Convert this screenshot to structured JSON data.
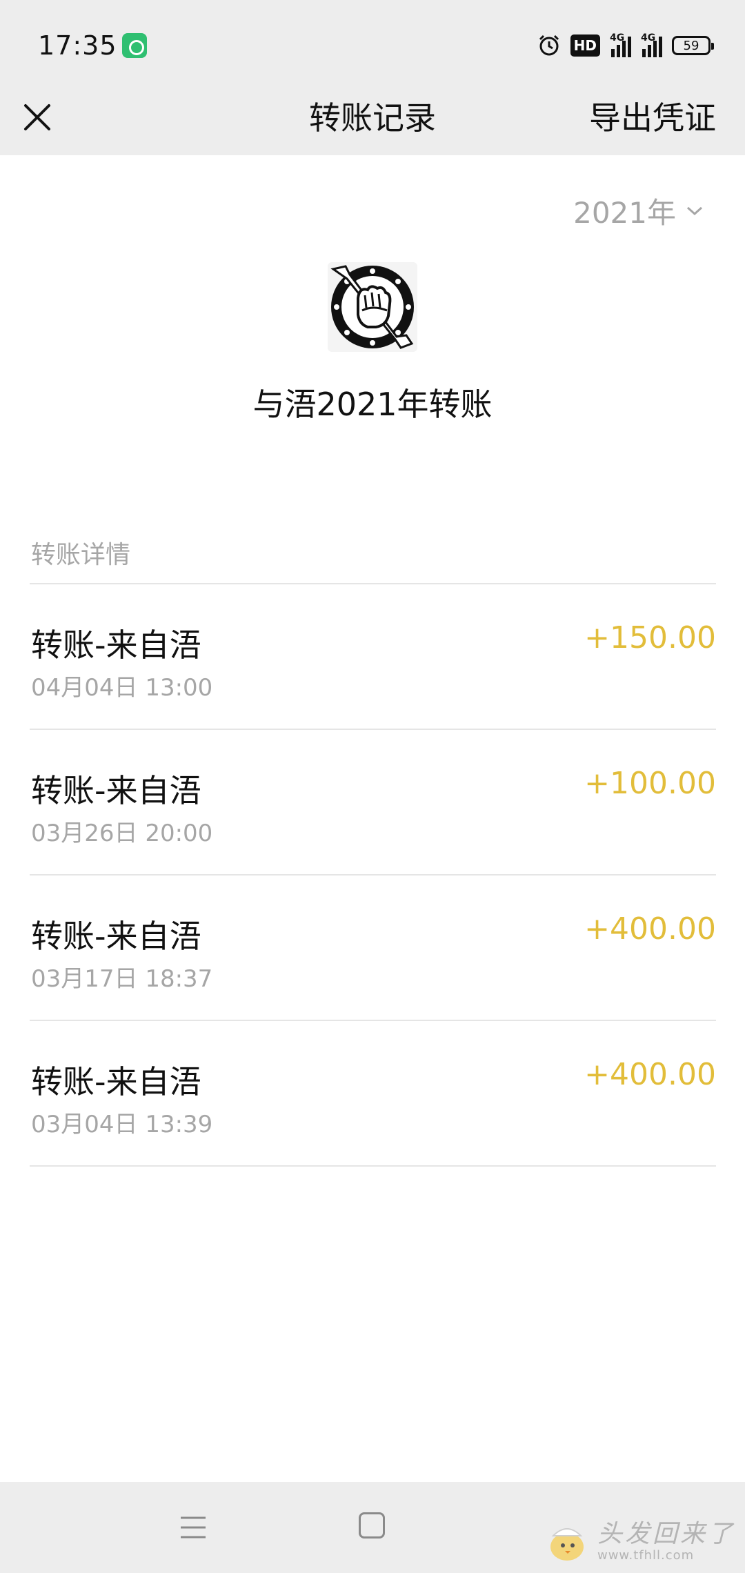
{
  "status_bar": {
    "time": "17:35",
    "hd_label": "HD",
    "signal_1_label": "4G",
    "signal_2_label": "4G",
    "battery_level": "59"
  },
  "nav": {
    "title": "转账记录",
    "export_label": "导出凭证"
  },
  "year_select": {
    "value": "2021年"
  },
  "header": {
    "title": "与浯2021年转账"
  },
  "section": {
    "label": "转账详情"
  },
  "transactions": [
    {
      "title": "转账-来自浯",
      "time": "04月04日 13:00",
      "amount": "+150.00"
    },
    {
      "title": "转账-来自浯",
      "time": "03月26日 20:00",
      "amount": "+100.00"
    },
    {
      "title": "转账-来自浯",
      "time": "03月17日 18:37",
      "amount": "+400.00"
    },
    {
      "title": "转账-来自浯",
      "time": "03月04日 13:39",
      "amount": "+400.00"
    }
  ],
  "watermark": {
    "text": "头发回来了",
    "url": "www.tfhll.com"
  },
  "colors": {
    "amount": "#e2bd3a",
    "muted": "#a6a6a6",
    "bar_bg": "#ededed",
    "badge_green": "#2fbf71"
  },
  "icons": {
    "close": "close-icon",
    "chevron": "chevron-down-icon",
    "menu": "menu-icon",
    "home": "home-icon"
  }
}
